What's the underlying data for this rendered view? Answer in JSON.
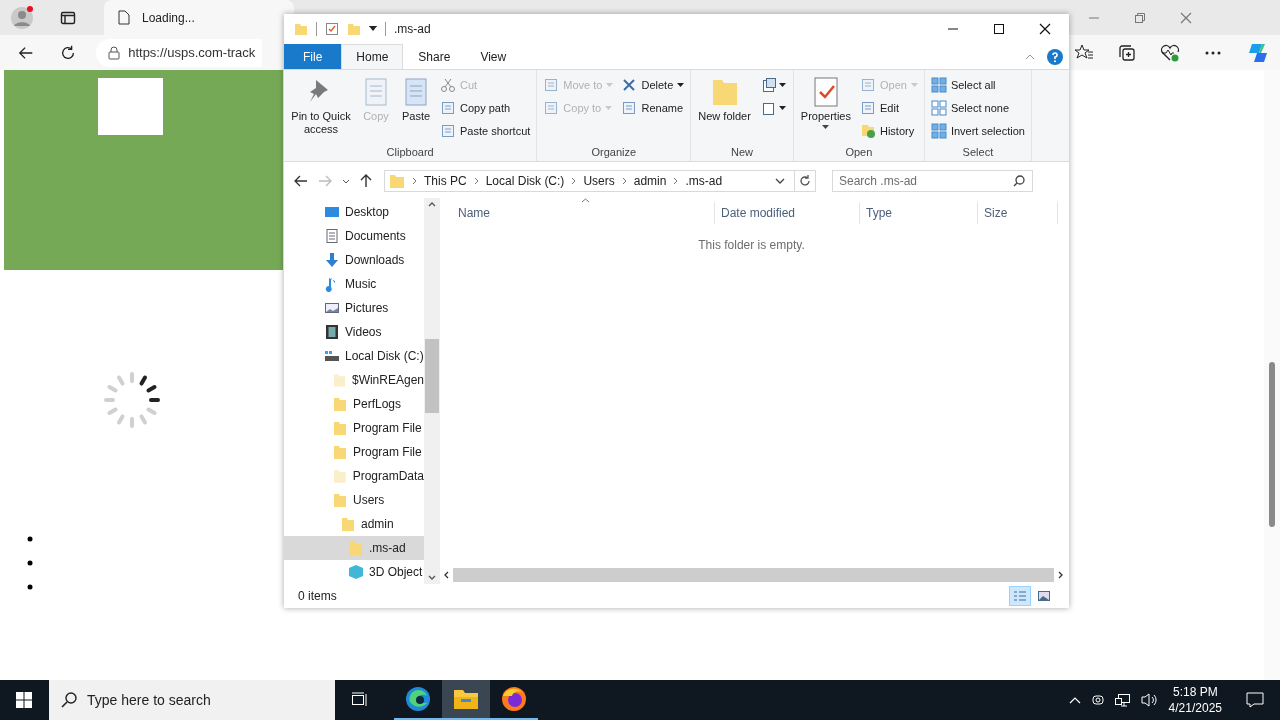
{
  "browser": {
    "tab_title": "Loading...",
    "url": "https://usps.com-track"
  },
  "explorer": {
    "title": ".ms-ad",
    "tabs": [
      {
        "label": "File",
        "kind": "file",
        "selected": false
      },
      {
        "label": "Home",
        "kind": "tab",
        "selected": true
      },
      {
        "label": "Share",
        "kind": "tab",
        "selected": false
      },
      {
        "label": "View",
        "kind": "tab",
        "selected": false
      }
    ],
    "ribbon": [
      {
        "label": "Clipboard",
        "columns": [
          [
            {
              "label": "Pin to Quick access",
              "kind": "large",
              "disabled": false
            }
          ],
          [
            {
              "label": "Copy",
              "kind": "large",
              "disabled": true
            }
          ],
          [
            {
              "label": "Paste",
              "kind": "large",
              "disabled": false
            }
          ],
          [
            {
              "label": "Cut",
              "kind": "small",
              "disabled": true
            },
            {
              "label": "Copy path",
              "kind": "small",
              "disabled": false
            },
            {
              "label": "Paste shortcut",
              "kind": "small",
              "disabled": false
            }
          ]
        ]
      },
      {
        "label": "Organize",
        "columns": [
          [
            {
              "label": "Move to",
              "kind": "small",
              "disabled": true,
              "dropdown": true
            },
            {
              "label": "Copy to",
              "kind": "small",
              "disabled": true,
              "dropdown": true
            }
          ],
          [
            {
              "label": "Delete",
              "kind": "small",
              "disabled": false,
              "dropdown": true
            },
            {
              "label": "Rename",
              "kind": "small",
              "disabled": false
            }
          ]
        ]
      },
      {
        "label": "New",
        "columns": [
          [
            {
              "label": "New folder",
              "kind": "large",
              "disabled": false
            }
          ],
          [
            {
              "kind": "icon",
              "disabled": false,
              "dropdown": true
            },
            {
              "kind": "icon",
              "disabled": false,
              "dropdown": true
            }
          ]
        ]
      },
      {
        "label": "Open",
        "columns": [
          [
            {
              "label": "Properties",
              "kind": "large",
              "disabled": false,
              "dropdown": true
            }
          ],
          [
            {
              "label": "Open",
              "kind": "small",
              "disabled": true,
              "dropdown": true
            },
            {
              "label": "Edit",
              "kind": "small",
              "disabled": false
            },
            {
              "label": "History",
              "kind": "small",
              "disabled": false
            }
          ]
        ]
      },
      {
        "label": "Select",
        "columns": [
          [
            {
              "label": "Select all",
              "kind": "small",
              "disabled": false
            },
            {
              "label": "Select none",
              "kind": "small",
              "disabled": false
            },
            {
              "label": "Invert selection",
              "kind": "small",
              "disabled": false
            }
          ]
        ]
      }
    ],
    "breadcrumbs": [
      "This PC",
      "Local Disk (C:)",
      "Users",
      "admin",
      ".ms-ad"
    ],
    "search": {
      "placeholder": "Search .ms-ad"
    },
    "tree": [
      {
        "label": "Desktop",
        "kind": "desktop",
        "selected": false
      },
      {
        "label": "Documents",
        "kind": "documents",
        "selected": false
      },
      {
        "label": "Downloads",
        "kind": "downloads",
        "selected": false
      },
      {
        "label": "Music",
        "kind": "music",
        "selected": false
      },
      {
        "label": "Pictures",
        "kind": "pictures",
        "selected": false
      },
      {
        "label": "Videos",
        "kind": "videos",
        "selected": false
      },
      {
        "label": "Local Disk (C:)",
        "kind": "drive",
        "selected": false,
        "children": [
          {
            "label": "$WinREAgen",
            "kind": "folder",
            "hidden": true,
            "selected": false
          },
          {
            "label": "PerfLogs",
            "kind": "folder",
            "hidden": false,
            "selected": false
          },
          {
            "label": "Program File",
            "kind": "folder",
            "hidden": false,
            "selected": false
          },
          {
            "label": "Program File",
            "kind": "folder",
            "hidden": false,
            "selected": false
          },
          {
            "label": "ProgramData",
            "kind": "folder",
            "hidden": true,
            "selected": false
          },
          {
            "label": "Users",
            "kind": "folder",
            "hidden": false,
            "selected": false,
            "children": [
              {
                "label": "admin",
                "kind": "folder",
                "hidden": false,
                "selected": false,
                "children": [
                  {
                    "label": ".ms-ad",
                    "kind": "folder",
                    "hidden": false,
                    "selected": true
                  },
                  {
                    "label": "3D Object",
                    "kind": "cube",
                    "selected": false
                  }
                ]
              }
            ]
          }
        ]
      }
    ],
    "columns": [
      "Name",
      "Date modified",
      "Type",
      "Size"
    ],
    "empty_message": "This folder is empty.",
    "status": "0 items"
  },
  "taskbar": {
    "search_placeholder": "Type here to search",
    "apps": [
      {
        "kind": "edge",
        "selected": false
      },
      {
        "kind": "explorer",
        "selected": true
      },
      {
        "kind": "firefox",
        "selected": false
      }
    ],
    "time": "5:18 PM",
    "date": "4/21/2025"
  }
}
